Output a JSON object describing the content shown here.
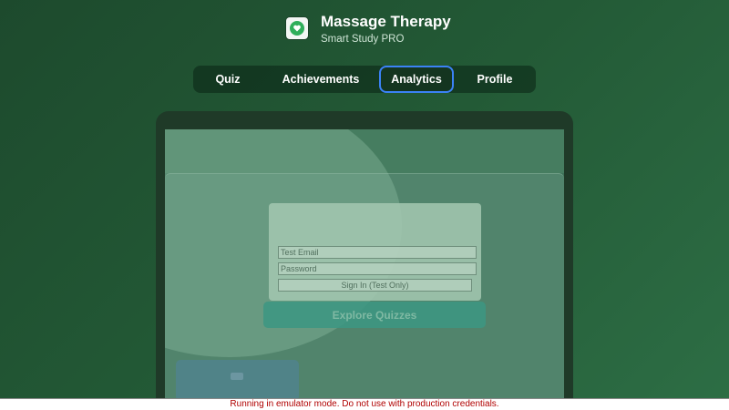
{
  "header": {
    "title": "Massage Therapy",
    "subtitle": "Smart Study PRO",
    "logo_icon": "heart-hands-icon"
  },
  "nav": {
    "tabs": [
      {
        "label": "Quiz",
        "active": false
      },
      {
        "label": "Achievements",
        "active": false
      },
      {
        "label": "Analytics",
        "active": true
      },
      {
        "label": "Profile",
        "active": false
      }
    ]
  },
  "login": {
    "email_placeholder": "Test Email",
    "password_placeholder": "Password",
    "signin_label": "Sign In (Test Only)"
  },
  "explore": {
    "label": "Explore Quizzes"
  },
  "warning": {
    "text": "Running in emulator mode. Do not use with production credentials."
  },
  "colors": {
    "accent": "#3b82f6",
    "brand": "#2fae5a",
    "warning": "#b00000"
  }
}
